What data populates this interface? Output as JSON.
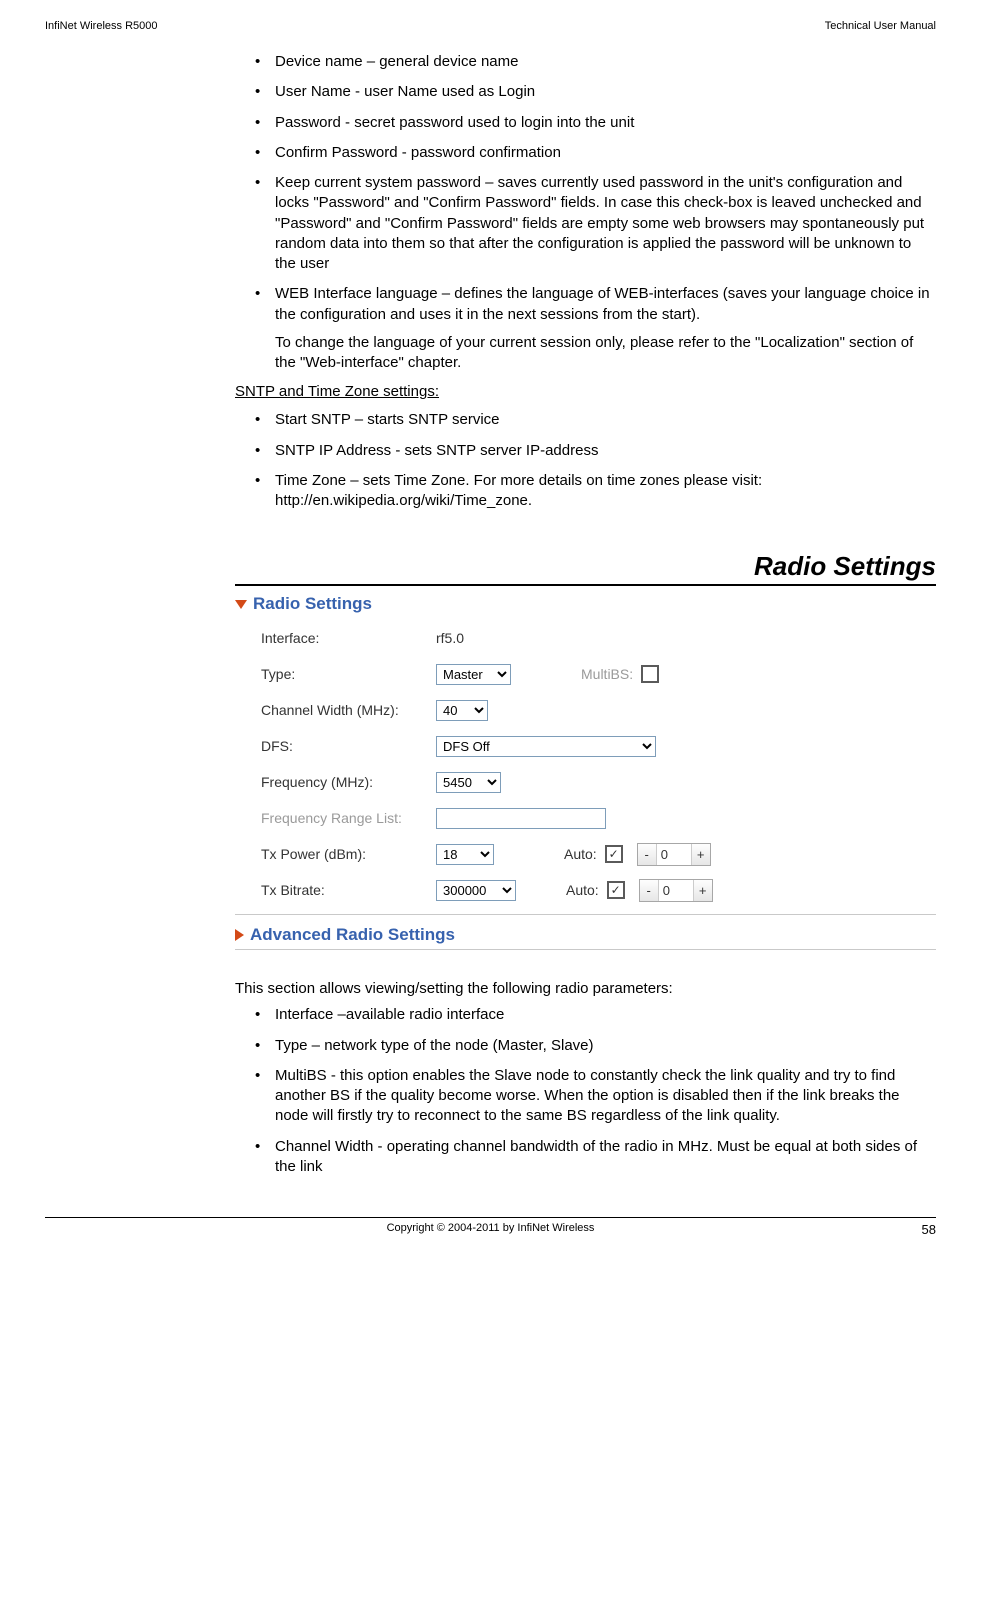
{
  "header": {
    "left": "InfiNet Wireless R5000",
    "right": "Technical User Manual"
  },
  "bullets1": [
    {
      "lead": "Device name – general device name"
    },
    {
      "lead": "User Name - user Name used as Login"
    },
    {
      "lead": "Password - secret password used to login into the unit"
    },
    {
      "lead": "Confirm Password - password confirmation"
    },
    {
      "lead": "Keep current system password – saves currently used password in the unit's configuration and locks \"Password\" and \"Confirm Password\" fields. In case this check-box is leaved unchecked and \"Password\" and \"Confirm Password\" fields are empty some web browsers may spontaneously put random data into them so that after the configuration is applied the password will be unknown to the user"
    },
    {
      "lead": "WEB Interface language – defines the language of WEB-interfaces (saves your language choice in the configuration and uses it in the next sessions from the start).",
      "extra": "To change the language of your current session only, please refer to the \"Localization\" section of the \"Web-interface\" chapter."
    }
  ],
  "sntp_heading": "SNTP and Time Zone settings:",
  "bullets2": [
    {
      "lead": "Start SNTP – starts SNTP service"
    },
    {
      "lead": "SNTP IP Address - sets SNTP server IP-address"
    },
    {
      "lead": "Time Zone – sets Time Zone. For more details on time zones please visit: http://en.wikipedia.org/wiki/Time_zone."
    }
  ],
  "section_title": "Radio Settings",
  "panel": {
    "title": "Radio Settings",
    "adv_title": "Advanced Radio Settings",
    "rows": {
      "interface": {
        "label": "Interface:",
        "value": "rf5.0"
      },
      "type": {
        "label": "Type:",
        "value": "Master",
        "multibs_label": "MultiBS:",
        "multibs_checked": false
      },
      "cw": {
        "label": "Channel Width (MHz):",
        "value": "40"
      },
      "dfs": {
        "label": "DFS:",
        "value": "DFS Off"
      },
      "freq": {
        "label": "Frequency (MHz):",
        "value": "5450"
      },
      "frl": {
        "label": "Frequency Range List:",
        "value": ""
      },
      "txp": {
        "label": "Tx Power (dBm):",
        "value": "18",
        "auto_label": "Auto:",
        "auto_checked": true,
        "step_val": "0"
      },
      "txb": {
        "label": "Tx Bitrate:",
        "value": "300000",
        "auto_label": "Auto:",
        "auto_checked": true,
        "step_val": "0"
      }
    }
  },
  "body_intro": "This section allows viewing/setting the following radio parameters:",
  "bullets3": [
    {
      "lead": "Interface –available radio interface"
    },
    {
      "lead": "Type – network type of the node (Master, Slave)"
    },
    {
      "lead": "MultiBS - this option enables the Slave node to constantly check the link quality and try to find another BS if the quality become worse. When the option is disabled then if the link breaks the node will firstly try to reconnect to the same BS regardless of the link quality."
    },
    {
      "lead": "Channel Width - operating channel bandwidth of the radio in MHz. Must be equal at both sides of the link"
    }
  ],
  "footer": {
    "copyright": "Copyright © 2004-2011 by InfiNet Wireless",
    "page": "58"
  }
}
